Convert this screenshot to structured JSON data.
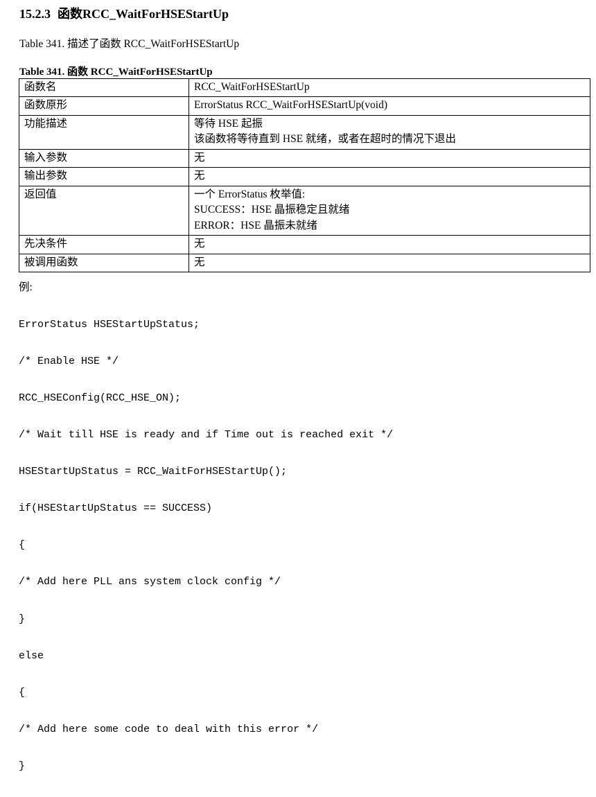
{
  "document": {
    "heading": {
      "number": "15.2.3",
      "title": "函数RCC_WaitForHSEStartUp"
    },
    "caption_intro": "Table 341. 描述了函数 RCC_WaitForHSEStartUp",
    "table_caption": "Table 341. 函数 RCC_WaitForHSEStartUp",
    "table": {
      "rows": [
        {
          "label": "函数名",
          "value_lines": [
            "RCC_WaitForHSEStartUp"
          ]
        },
        {
          "label": "函数原形",
          "value_lines": [
            "ErrorStatus RCC_WaitForHSEStartUp(void)"
          ]
        },
        {
          "label": "功能描述",
          "value_lines": [
            "等待 HSE 起振",
            "该函数将等待直到 HSE 就绪，或者在超时的情况下退出"
          ]
        },
        {
          "label": "输入参数",
          "value_lines": [
            "无"
          ]
        },
        {
          "label": "输出参数",
          "value_lines": [
            "无"
          ]
        },
        {
          "label": "返回值",
          "value_lines": [
            "一个 ErrorStatus 枚举值:",
            "SUCCESS：HSE 晶振稳定且就绪",
            "ERROR：HSE 晶振未就绪"
          ]
        },
        {
          "label": "先决条件",
          "value_lines": [
            "无"
          ]
        },
        {
          "label": "被调用函数",
          "value_lines": [
            "无"
          ]
        }
      ]
    },
    "example": {
      "label": "例:",
      "code_lines": [
        "ErrorStatus HSEStartUpStatus;",
        "/* Enable HSE */",
        "RCC_HSEConfig(RCC_HSE_ON);",
        "/* Wait till HSE is ready and if Time out is reached exit */",
        "HSEStartUpStatus = RCC_WaitForHSEStartUp();",
        "if(HSEStartUpStatus == SUCCESS)",
        "{",
        "/* Add here PLL ans system clock config */",
        "}",
        "else",
        "{",
        "/* Add here some code to deal with this error */",
        "}"
      ]
    }
  }
}
